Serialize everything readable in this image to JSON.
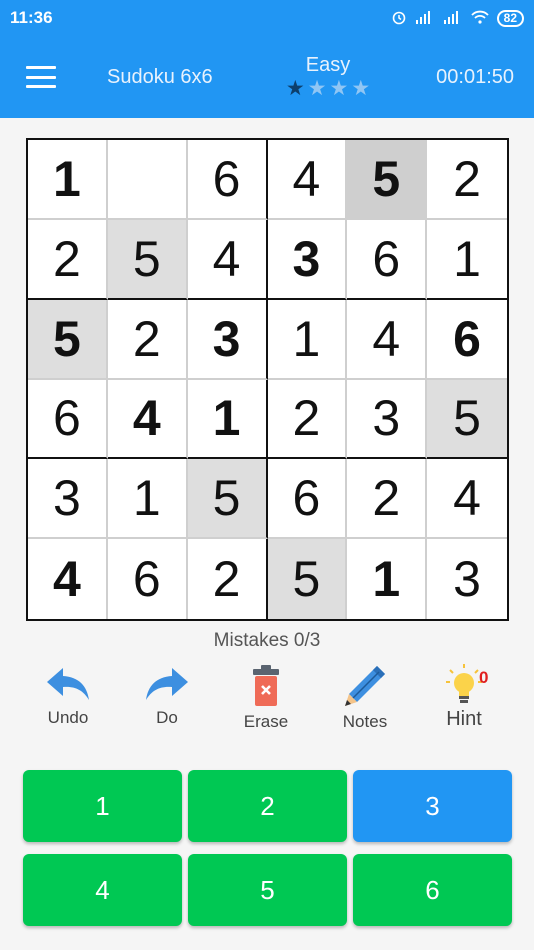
{
  "status_bar": {
    "time": "11:36",
    "battery": "82"
  },
  "app_bar": {
    "title": "Sudoku 6x6",
    "difficulty": "Easy",
    "stars_filled": 1,
    "stars_total": 4,
    "timer": "00:01:50"
  },
  "board": {
    "cells": [
      [
        {
          "v": "1",
          "given": true
        },
        {
          "v": "",
          "given": false
        },
        {
          "v": "6",
          "given": false
        },
        {
          "v": "4",
          "given": false
        },
        {
          "v": "5",
          "given": true,
          "selected": true
        },
        {
          "v": "2",
          "given": false
        }
      ],
      [
        {
          "v": "2",
          "given": false
        },
        {
          "v": "5",
          "given": false,
          "shade": true
        },
        {
          "v": "4",
          "given": false
        },
        {
          "v": "3",
          "given": true
        },
        {
          "v": "6",
          "given": false
        },
        {
          "v": "1",
          "given": false
        }
      ],
      [
        {
          "v": "5",
          "given": true,
          "shade": true
        },
        {
          "v": "2",
          "given": false
        },
        {
          "v": "3",
          "given": true
        },
        {
          "v": "1",
          "given": false
        },
        {
          "v": "4",
          "given": false
        },
        {
          "v": "6",
          "given": true
        }
      ],
      [
        {
          "v": "6",
          "given": false
        },
        {
          "v": "4",
          "given": true
        },
        {
          "v": "1",
          "given": true
        },
        {
          "v": "2",
          "given": false
        },
        {
          "v": "3",
          "given": false
        },
        {
          "v": "5",
          "given": false,
          "shade": true
        }
      ],
      [
        {
          "v": "3",
          "given": false
        },
        {
          "v": "1",
          "given": false
        },
        {
          "v": "5",
          "given": false,
          "shade": true
        },
        {
          "v": "6",
          "given": false
        },
        {
          "v": "2",
          "given": false
        },
        {
          "v": "4",
          "given": false
        }
      ],
      [
        {
          "v": "4",
          "given": true
        },
        {
          "v": "6",
          "given": false
        },
        {
          "v": "2",
          "given": false
        },
        {
          "v": "5",
          "given": false,
          "shade": true
        },
        {
          "v": "1",
          "given": true
        },
        {
          "v": "3",
          "given": false
        }
      ]
    ]
  },
  "mistakes": "Mistakes 0/3",
  "tools": {
    "undo": "Undo",
    "redo": "Do",
    "erase": "Erase",
    "notes": "Notes",
    "hint": "Hint",
    "hint_count": "0"
  },
  "numpad": {
    "buttons": [
      "1",
      "2",
      "3",
      "4",
      "5",
      "6"
    ],
    "active": "3"
  },
  "colors": {
    "primary": "#2196f3",
    "number_button": "#00c853"
  }
}
